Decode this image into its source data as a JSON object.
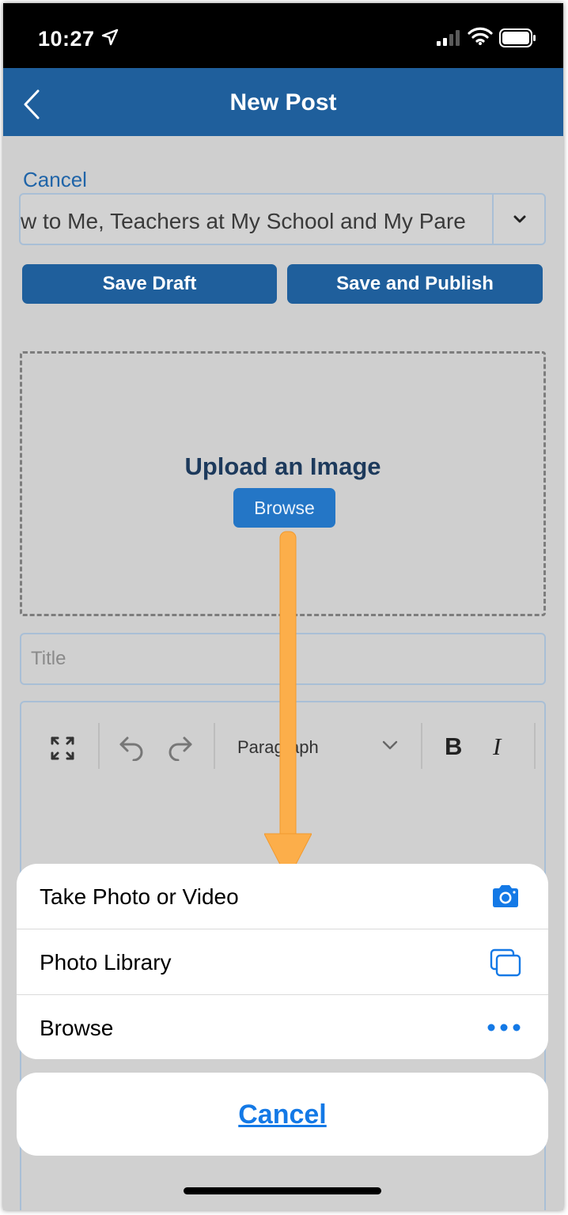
{
  "status_bar": {
    "time": "10:27",
    "icons": [
      "location-arrow-icon",
      "signal-icon",
      "wifi-icon",
      "battery-icon"
    ]
  },
  "nav": {
    "title": "New Post",
    "back_icon": "chevron-left-icon"
  },
  "form": {
    "cancel_label": "Cancel",
    "visibility_value": "w to Me, Teachers at My School and My Pare",
    "save_draft_label": "Save Draft",
    "save_publish_label": "Save and Publish"
  },
  "upload": {
    "heading": "Upload an Image",
    "browse_label": "Browse"
  },
  "title_field": {
    "placeholder": "Title"
  },
  "editor_toolbar": {
    "format_value": "Paragraph",
    "bold_label": "B",
    "italic_label": "I"
  },
  "action_sheet": {
    "items": [
      {
        "label": "Take Photo or Video",
        "icon": "camera-icon"
      },
      {
        "label": "Photo Library",
        "icon": "photo-library-icon"
      },
      {
        "label": "Browse",
        "icon": "more-dots-icon"
      }
    ],
    "cancel_label": "Cancel"
  },
  "colors": {
    "nav_blue": "#1f5f9c",
    "link_blue": "#1479e6",
    "annotation_orange": "#fcae4a"
  }
}
